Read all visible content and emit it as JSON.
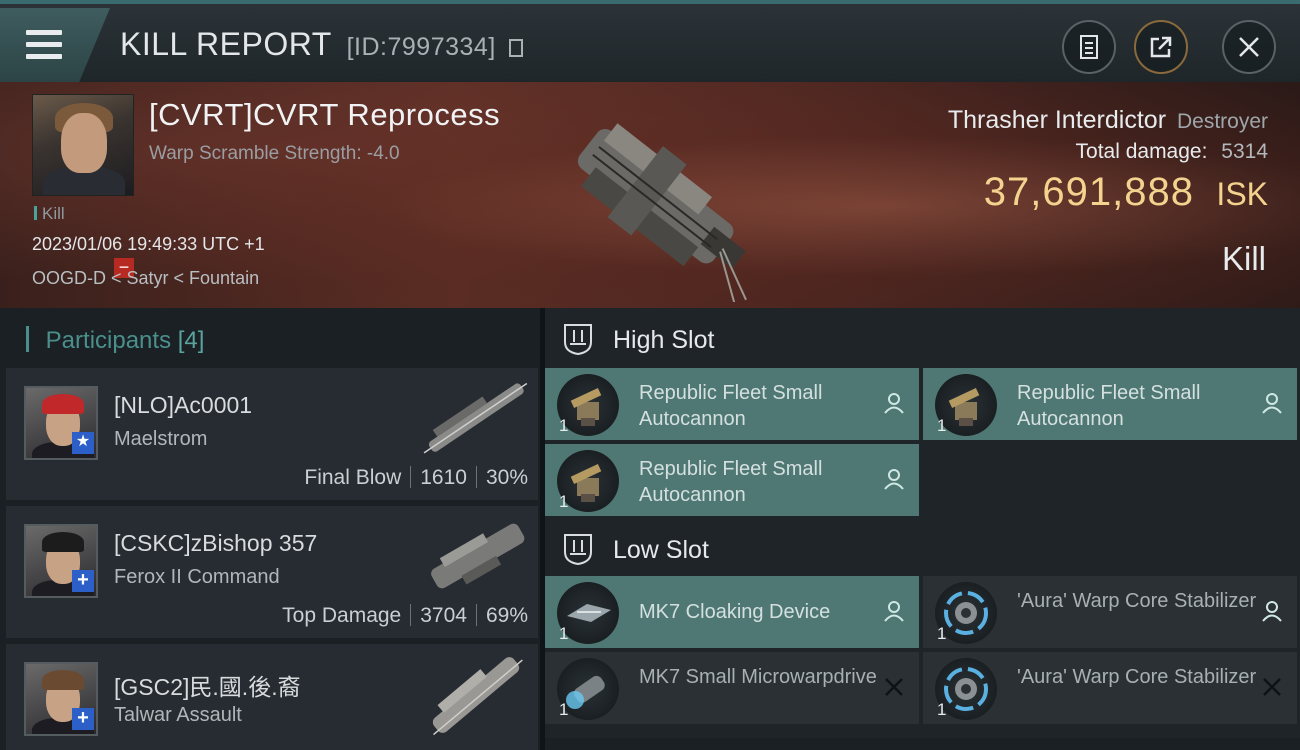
{
  "header": {
    "title": "KILL REPORT",
    "report_id": "[ID:7997334]"
  },
  "victim": {
    "name": "[CVRT]CVRT Reprocess",
    "warp_scramble": "Warp Scramble Strength: -4.0",
    "tag": "Kill",
    "timestamp": "2023/01/06 19:49:33 UTC +1",
    "location": "OOGD-D < Satyr < Fountain",
    "ship_name": "Thrasher Interdictor",
    "ship_class": "Destroyer",
    "damage_label": "Total damage:",
    "damage_value": "5314",
    "isk_value": "37,691,888",
    "isk_unit": "ISK",
    "kill_type": "Kill"
  },
  "participants": {
    "label": "Participants",
    "count": "[4]",
    "items": [
      {
        "name": "[NLO]Ac0001",
        "ship": "Maelstrom",
        "role": "Final Blow",
        "damage": "1610",
        "percent": "30%",
        "hair_color": "#c0282a"
      },
      {
        "name": "[CSKC]zBishop 357",
        "ship": "Ferox II Command",
        "role": "Top Damage",
        "damage": "3704",
        "percent": "69%",
        "hair_color": "#1c1c1c"
      },
      {
        "name": "[GSC2]民.國.後.裔",
        "ship": "Talwar Assault",
        "role": "",
        "damage": "",
        "percent": "",
        "hair_color": "#6a4a30"
      }
    ]
  },
  "fitting": {
    "high_slot": {
      "title": "High Slot",
      "modules": [
        {
          "qty": "1",
          "name": "Republic Fleet Small Autocannon",
          "status": "fitted",
          "icon": "autocannon-icon"
        },
        {
          "qty": "1",
          "name": "Republic Fleet Small Autocannon",
          "status": "fitted",
          "icon": "autocannon-icon"
        },
        {
          "qty": "1",
          "name": "Republic Fleet Small Autocannon",
          "status": "fitted",
          "icon": "autocannon-icon"
        }
      ]
    },
    "low_slot": {
      "title": "Low Slot",
      "modules": [
        {
          "qty": "1",
          "name": "MK7 Cloaking Device",
          "status": "fitted",
          "icon": "cloak-icon"
        },
        {
          "qty": "1",
          "name": "'Aura' Warp Core Stabilizer",
          "status": "fitted",
          "icon": "warp-core-icon"
        },
        {
          "qty": "1",
          "name": "MK7 Small Microwarpdrive",
          "status": "destroyed",
          "icon": "mwd-icon"
        },
        {
          "qty": "1",
          "name": "'Aura' Warp Core Stabilizer",
          "status": "destroyed",
          "icon": "warp-core-icon"
        }
      ]
    }
  },
  "colors": {
    "accent": "#4a8f8c",
    "isk": "#f4d38f",
    "fitted_bg": "#4f7874",
    "lost_bg": "#2a3034",
    "danger": "#b72a22",
    "badge_blue": "#2c5fc8"
  }
}
